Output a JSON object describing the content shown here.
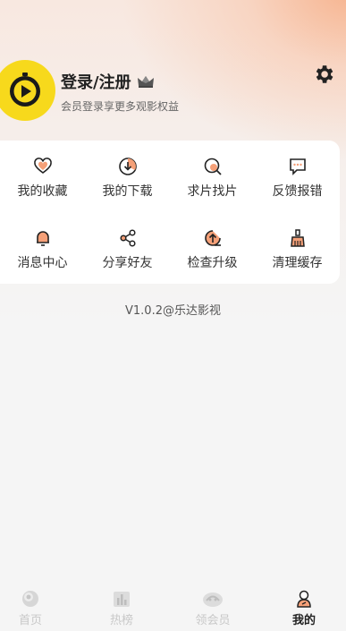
{
  "header": {
    "login_title": "登录/注册",
    "login_subtitle": "会员登录享更多观影权益"
  },
  "grid": {
    "items": [
      {
        "label": "我的收藏",
        "icon": "heart-icon"
      },
      {
        "label": "我的下载",
        "icon": "download-icon"
      },
      {
        "label": "求片找片",
        "icon": "search-film-icon"
      },
      {
        "label": "反馈报错",
        "icon": "feedback-icon"
      },
      {
        "label": "消息中心",
        "icon": "bell-icon"
      },
      {
        "label": "分享好友",
        "icon": "share-icon"
      },
      {
        "label": "检查升级",
        "icon": "upgrade-icon"
      },
      {
        "label": "清理缓存",
        "icon": "clean-cache-icon"
      }
    ]
  },
  "footer": {
    "version": "V1.0.2@乐达影视"
  },
  "tabbar": {
    "tabs": [
      {
        "label": "首页",
        "icon": "home-icon",
        "active": false
      },
      {
        "label": "热榜",
        "icon": "chart-icon",
        "active": false
      },
      {
        "label": "领会员",
        "icon": "vip-icon",
        "active": false
      },
      {
        "label": "我的",
        "icon": "profile-icon",
        "active": true
      }
    ]
  },
  "colors": {
    "accent": "#f7d91c",
    "highlight": "#f5a078",
    "text_primary": "#222222",
    "inactive_tab": "#c8c8c8"
  }
}
